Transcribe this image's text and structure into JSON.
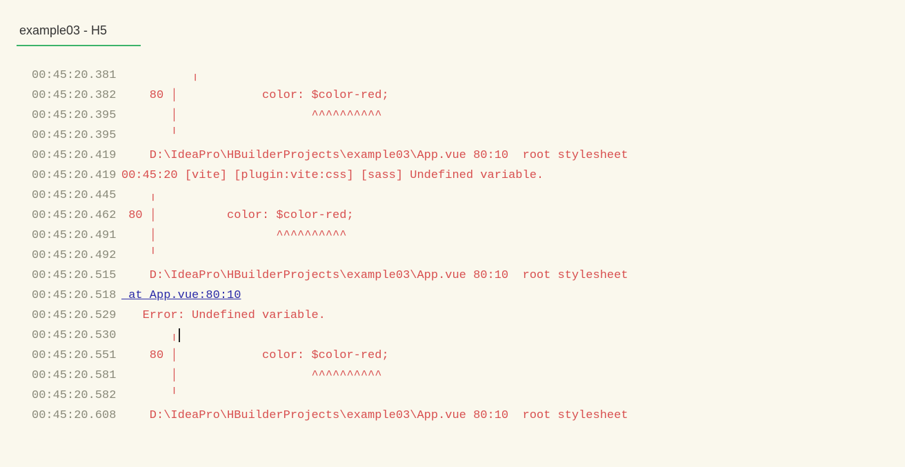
{
  "tab": {
    "label": "example03 - H5"
  },
  "lines": [
    {
      "ts": "00:45:20.381",
      "msg": "          ╷"
    },
    {
      "ts": "00:45:20.382",
      "msg": "    80 │            color: $color-red;"
    },
    {
      "ts": "00:45:20.395",
      "msg": "       │                   ^^^^^^^^^^"
    },
    {
      "ts": "00:45:20.395",
      "msg": "       ╵"
    },
    {
      "ts": "00:45:20.419",
      "msg": "    D:\\IdeaPro\\HBuilderProjects\\example03\\App.vue 80:10  root stylesheet"
    },
    {
      "ts": "00:45:20.419",
      "msg": "00:45:20 [vite] [plugin:vite:css] [sass] Undefined variable."
    },
    {
      "ts": "00:45:20.445",
      "msg": "    ╷"
    },
    {
      "ts": "00:45:20.462",
      "msg": " 80 │          color: $color-red;"
    },
    {
      "ts": "00:45:20.491",
      "msg": "    │                 ^^^^^^^^^^"
    },
    {
      "ts": "00:45:20.492",
      "msg": "    ╵"
    },
    {
      "ts": "00:45:20.515",
      "msg": "    D:\\IdeaPro\\HBuilderProjects\\example03\\App.vue 80:10  root stylesheet"
    },
    {
      "ts": "00:45:20.518",
      "msg": " at App.vue:80:10",
      "isLink": true
    },
    {
      "ts": "00:45:20.529",
      "msg": "   Error: Undefined variable."
    },
    {
      "ts": "00:45:20.530",
      "msg": "       ╷",
      "hasCursor": true
    },
    {
      "ts": "00:45:20.551",
      "msg": "    80 │            color: $color-red;"
    },
    {
      "ts": "00:45:20.581",
      "msg": "       │                   ^^^^^^^^^^"
    },
    {
      "ts": "00:45:20.582",
      "msg": "       ╵"
    },
    {
      "ts": "00:45:20.608",
      "msg": "    D:\\IdeaPro\\HBuilderProjects\\example03\\App.vue 80:10  root stylesheet"
    }
  ]
}
